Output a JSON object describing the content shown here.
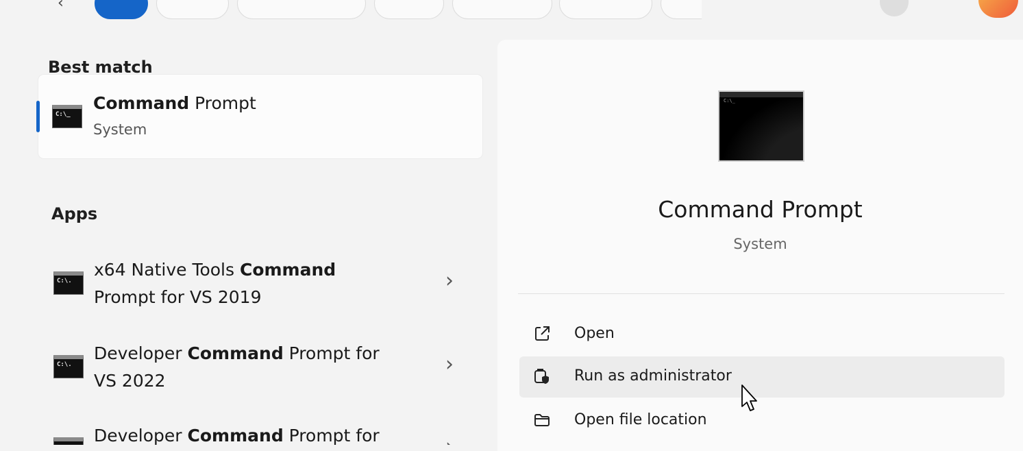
{
  "best_match": {
    "heading": "Best match",
    "title_bold": "Command",
    "title_rest": " Prompt",
    "subtitle": "System",
    "icon_text": "C:\\_"
  },
  "apps": {
    "heading": "Apps",
    "items": [
      {
        "line1_pre": "x64 Native Tools ",
        "line1_bold": "Command",
        "line1_post": "",
        "line2": "Prompt for VS 2019",
        "icon_text": "C:\\."
      },
      {
        "line1_pre": "Developer ",
        "line1_bold": "Command",
        "line1_post": " Prompt for",
        "line2": "VS 2022",
        "icon_text": "C:\\."
      },
      {
        "line1_pre": "Developer ",
        "line1_bold": "Command",
        "line1_post": " Prompt for",
        "line2": "",
        "icon_text": ""
      }
    ]
  },
  "preview": {
    "title": "Command Prompt",
    "subtitle": "System",
    "icon_text": "C:\\_"
  },
  "actions": [
    {
      "label": "Open",
      "icon": "open-external-icon"
    },
    {
      "label": "Run as administrator",
      "icon": "shield-admin-icon"
    },
    {
      "label": "Open file location",
      "icon": "folder-icon"
    }
  ],
  "colors": {
    "accent": "#1565c8",
    "background": "#f3f3f3",
    "panel": "#fafafa",
    "hover": "#ececec"
  }
}
